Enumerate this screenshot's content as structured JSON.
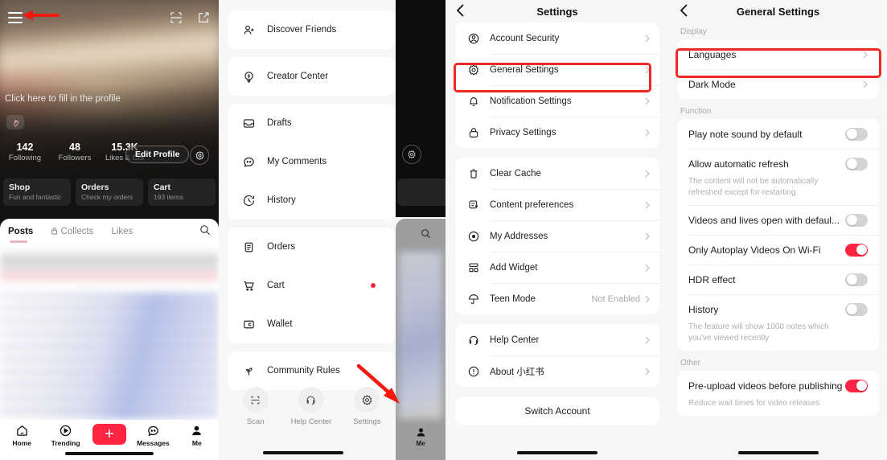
{
  "colors": {
    "accent": "#ff2442",
    "highlight": "#ee2a22",
    "toggle_off": "#d4d4d4"
  },
  "panel1": {
    "name": "profile-screen",
    "fill_profile_text": "Click here to fill in the profile",
    "stats": [
      {
        "number": "142",
        "label": "Following"
      },
      {
        "number": "48",
        "label": "Followers"
      },
      {
        "number": "15.3K",
        "label": "Likes & Col"
      }
    ],
    "edit_profile_label": "Edit Profile",
    "cards": [
      {
        "title": "Shop",
        "subtitle": "Fun and fantastic"
      },
      {
        "title": "Orders",
        "subtitle": "Check my orders"
      },
      {
        "title": "Cart",
        "subtitle": "193 items"
      }
    ],
    "tabs": [
      {
        "label": "Posts",
        "active": true
      },
      {
        "label": "Collects",
        "active": false
      },
      {
        "label": "Likes",
        "active": false
      }
    ],
    "bottom_nav": [
      {
        "label": "Home",
        "icon": "home-icon"
      },
      {
        "label": "Trending",
        "icon": "play-circle-icon"
      },
      {
        "label": "",
        "icon": "plus-icon"
      },
      {
        "label": "Messages",
        "icon": "chat-icon"
      },
      {
        "label": "Me",
        "icon": "person-icon"
      }
    ]
  },
  "panel2": {
    "name": "side-drawer",
    "groups": [
      [
        {
          "label": "Discover Friends",
          "icon": "person-add-icon"
        }
      ],
      [
        {
          "label": "Creator Center",
          "icon": "bulb-icon"
        }
      ],
      [
        {
          "label": "Drafts",
          "icon": "inbox-icon"
        },
        {
          "label": "My Comments",
          "icon": "comment-icon"
        },
        {
          "label": "History",
          "icon": "clock-icon"
        }
      ],
      [
        {
          "label": "Orders",
          "icon": "clipboard-icon"
        },
        {
          "label": "Cart",
          "icon": "cart-icon",
          "badge": true
        },
        {
          "label": "Wallet",
          "icon": "wallet-icon"
        }
      ],
      [
        {
          "label": "Community Rules",
          "icon": "sprout-icon"
        }
      ]
    ],
    "bottom_actions": [
      {
        "label": "Scan",
        "icon": "scan-icon"
      },
      {
        "label": "Help Center",
        "icon": "headset-icon"
      },
      {
        "label": "Settings",
        "icon": "gear-icon"
      }
    ],
    "behind_me_label": "Me"
  },
  "panel3": {
    "name": "settings-screen",
    "title": "Settings",
    "groups": [
      [
        {
          "label": "Account Security",
          "icon": "account-icon"
        },
        {
          "label": "General Settings",
          "icon": "gear-icon",
          "highlighted": true
        },
        {
          "label": "Notification Settings",
          "icon": "bell-icon"
        },
        {
          "label": "Privacy Settings",
          "icon": "lock-icon"
        }
      ],
      [
        {
          "label": "Clear Cache",
          "icon": "trash-icon"
        },
        {
          "label": "Content preferences",
          "icon": "content-icon"
        },
        {
          "label": "My Addresses",
          "icon": "location-icon"
        },
        {
          "label": "Add Widget",
          "icon": "widget-icon"
        },
        {
          "label": "Teen Mode",
          "icon": "umbrella-icon",
          "value": "Not Enabled"
        }
      ],
      [
        {
          "label": "Help Center",
          "icon": "headset-icon"
        },
        {
          "label": "About 小红书",
          "icon": "info-icon"
        }
      ]
    ],
    "switch_account_label": "Switch Account"
  },
  "panel4": {
    "name": "general-settings-screen",
    "title": "General Settings",
    "sections": [
      {
        "label": "Display",
        "rows": [
          {
            "label": "Languages",
            "type": "chevron",
            "highlighted": true
          },
          {
            "label": "Dark Mode",
            "type": "chevron"
          }
        ]
      },
      {
        "label": "Function",
        "rows": [
          {
            "label": "Play note sound by default",
            "type": "toggle",
            "on": false
          },
          {
            "label": "Allow automatic refresh",
            "type": "toggle",
            "on": false,
            "desc": "The content will not be automatically refreshed except for restarting"
          },
          {
            "label": "Videos and lives open with defaul...",
            "type": "toggle",
            "on": false
          },
          {
            "label": "Only Autoplay Videos On Wi-Fi",
            "type": "toggle",
            "on": true
          },
          {
            "label": "HDR effect",
            "type": "toggle",
            "on": false
          },
          {
            "label": "History",
            "type": "toggle",
            "on": false,
            "desc": "The feature will show 1000 notes which you've viewed recently"
          }
        ]
      },
      {
        "label": "Other",
        "rows": [
          {
            "label": "Pre-upload videos before publishing",
            "type": "toggle",
            "on": true,
            "desc": "Reduce wait times for video releases"
          }
        ]
      }
    ]
  }
}
